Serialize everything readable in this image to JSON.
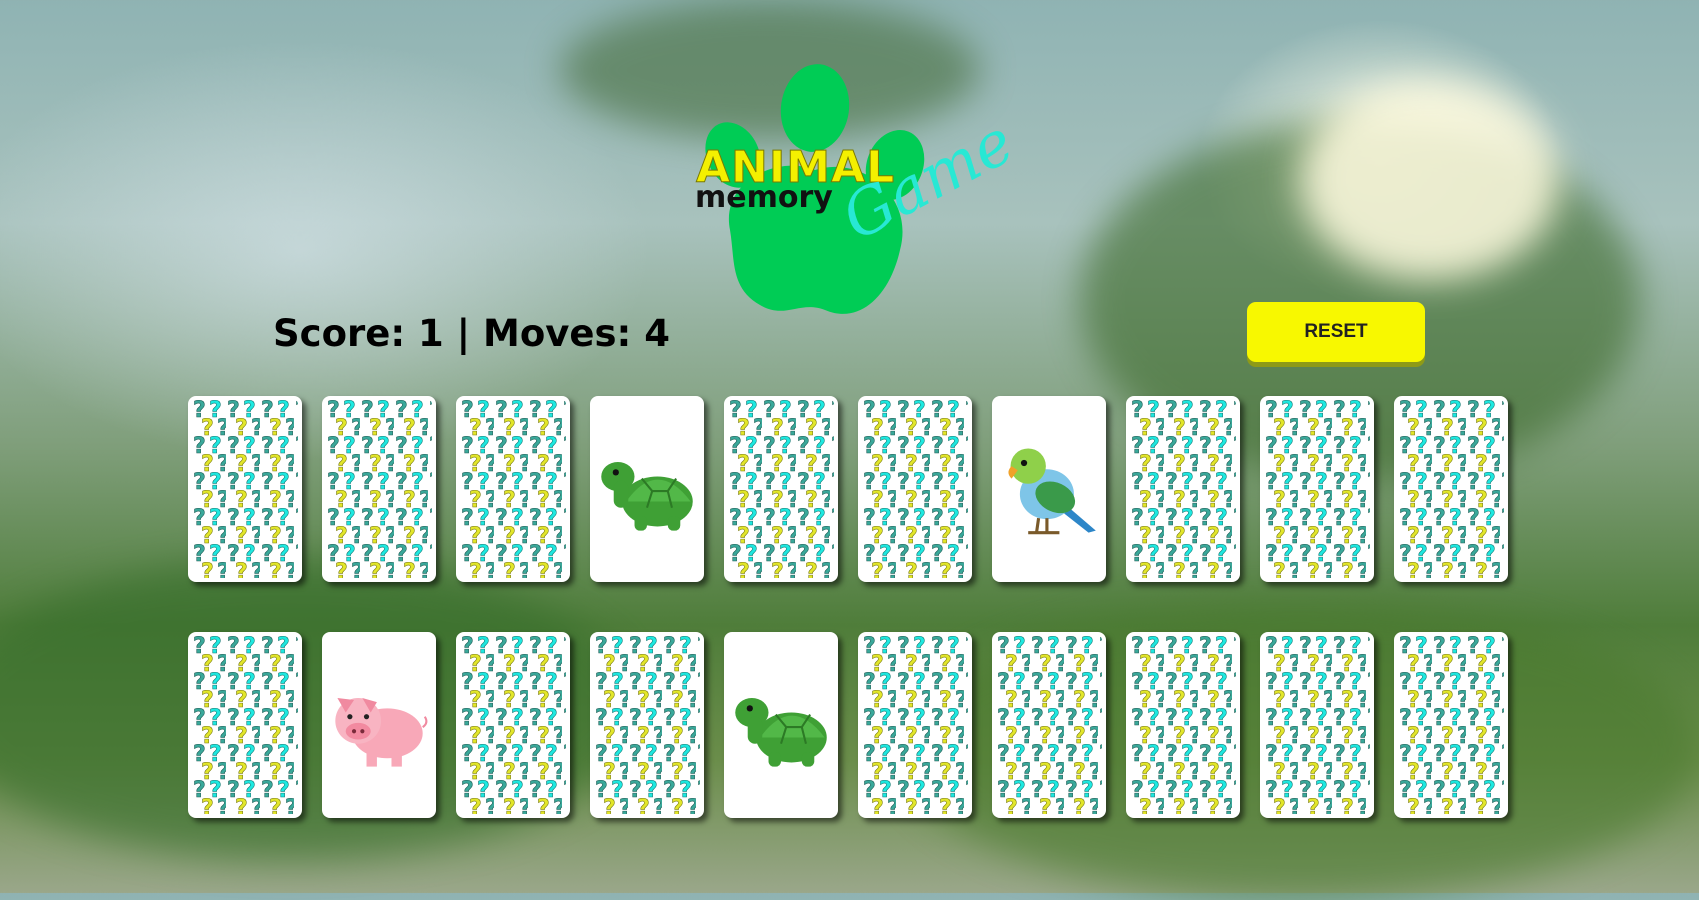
{
  "logo": {
    "word1": "ANIMAL",
    "word2": "memory",
    "word3": "Game",
    "paw_color": "#00cc55"
  },
  "status": {
    "text": "Score: 1 | Moves: 4"
  },
  "controls": {
    "reset_label": "RESET"
  },
  "colors": {
    "reset_bg": "#f8f800",
    "pattern_teal": "#3aa89a",
    "pattern_cyan": "#1ee8e0",
    "pattern_yellow": "#e2e62a"
  },
  "board": {
    "rows": [
      [
        {
          "state": "hidden",
          "animal": ""
        },
        {
          "state": "hidden",
          "animal": ""
        },
        {
          "state": "hidden",
          "animal": ""
        },
        {
          "state": "revealed",
          "animal": "turtle"
        },
        {
          "state": "hidden",
          "animal": ""
        },
        {
          "state": "hidden",
          "animal": ""
        },
        {
          "state": "revealed",
          "animal": "bird"
        },
        {
          "state": "hidden",
          "animal": ""
        },
        {
          "state": "hidden",
          "animal": ""
        },
        {
          "state": "hidden",
          "animal": ""
        }
      ],
      [
        {
          "state": "hidden",
          "animal": ""
        },
        {
          "state": "revealed",
          "animal": "pig"
        },
        {
          "state": "hidden",
          "animal": ""
        },
        {
          "state": "hidden",
          "animal": ""
        },
        {
          "state": "revealed",
          "animal": "turtle"
        },
        {
          "state": "hidden",
          "animal": ""
        },
        {
          "state": "hidden",
          "animal": ""
        },
        {
          "state": "hidden",
          "animal": ""
        },
        {
          "state": "hidden",
          "animal": ""
        },
        {
          "state": "hidden",
          "animal": ""
        }
      ]
    ]
  }
}
